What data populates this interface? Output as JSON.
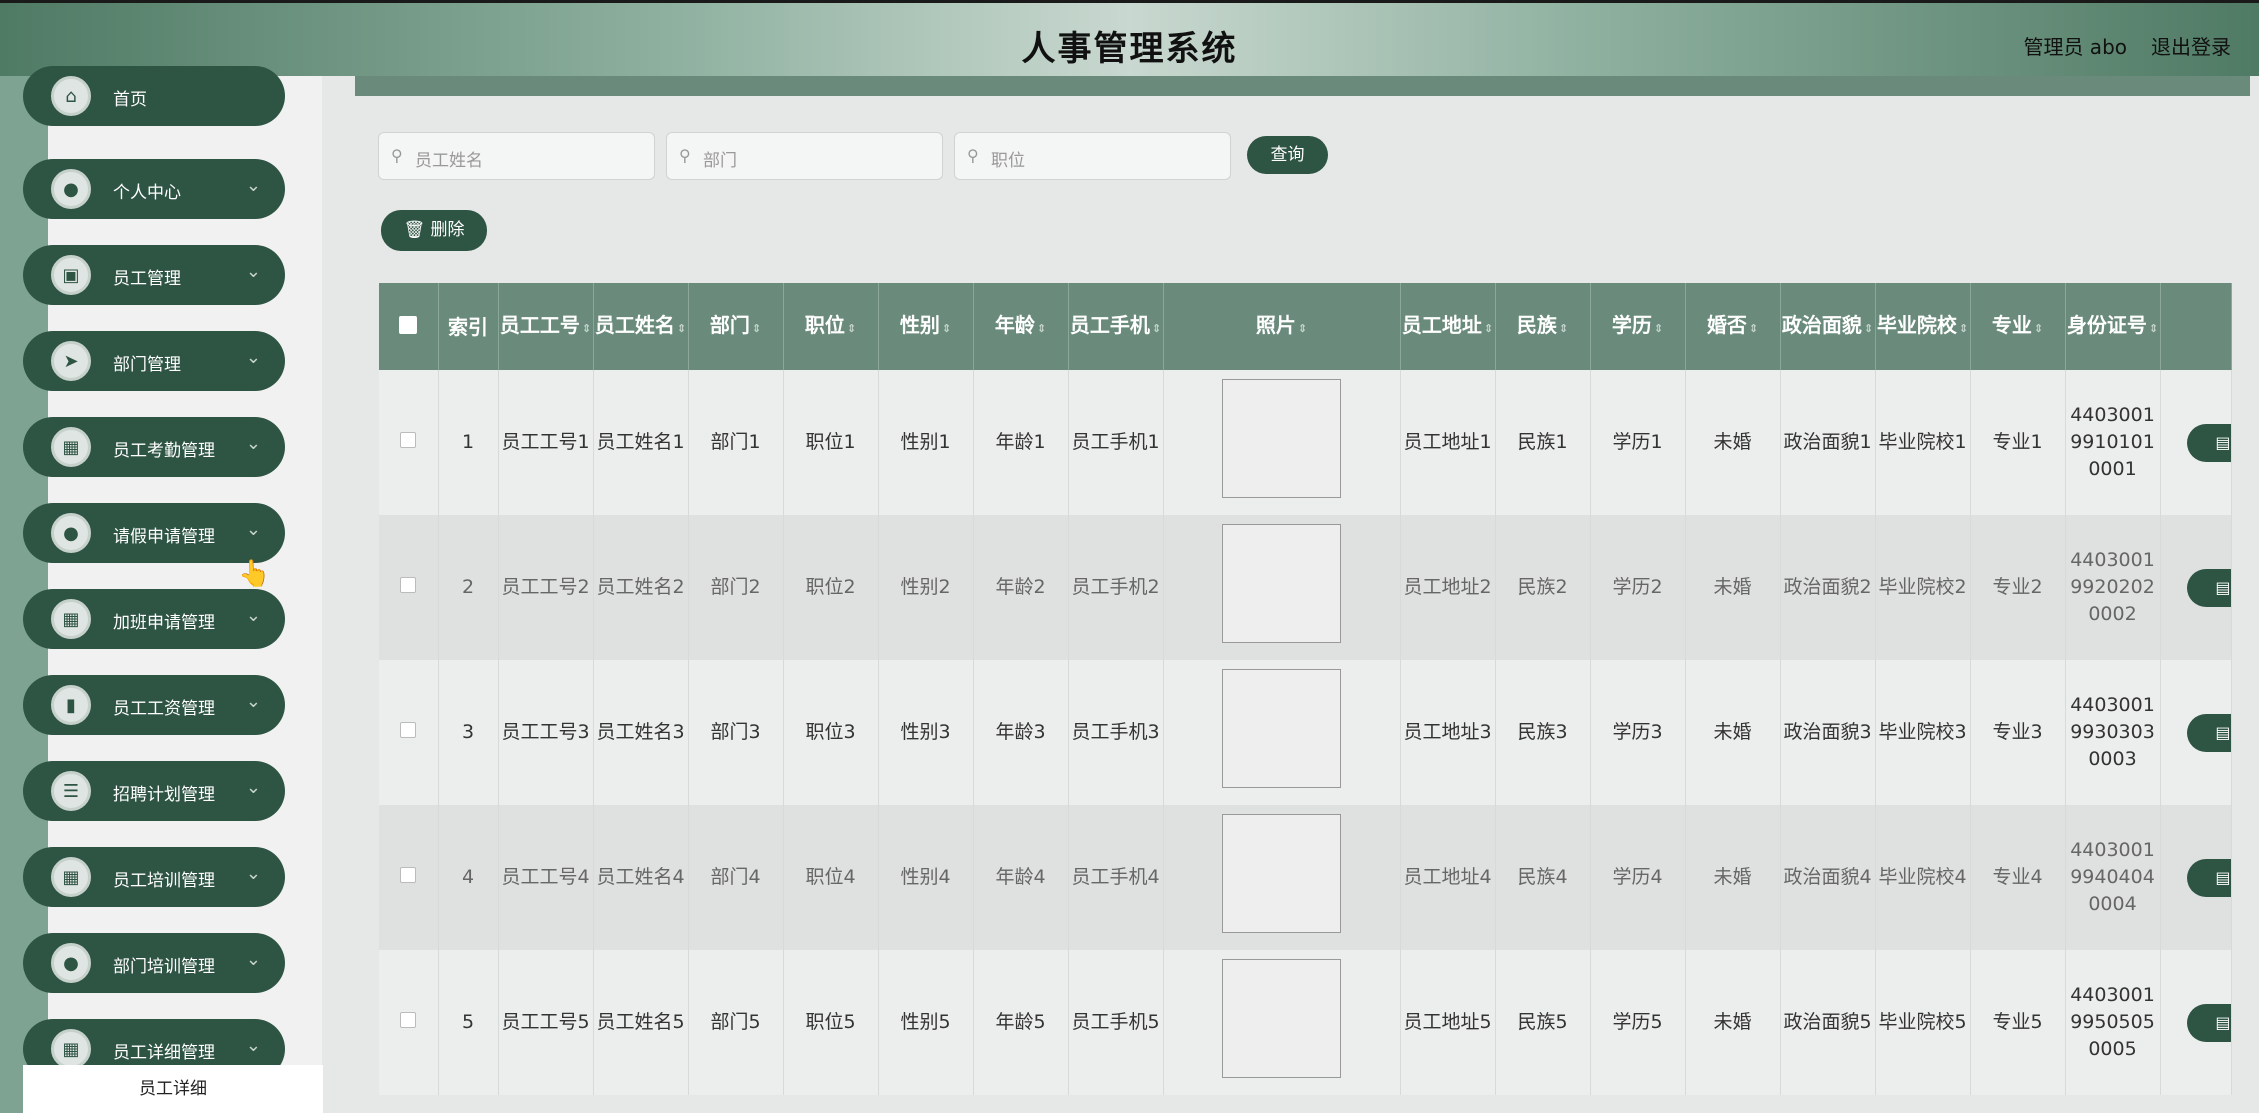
{
  "header": {
    "title": "人事管理系统",
    "user": "管理员 abo",
    "logout": "退出登录"
  },
  "sidebar": {
    "items": [
      {
        "label": "首页",
        "icon": "home-icon",
        "glyph": "⌂",
        "chevron": false
      },
      {
        "label": "个人中心",
        "icon": "user-icon",
        "glyph": "●",
        "chevron": true
      },
      {
        "label": "员工管理",
        "icon": "briefcase-icon",
        "glyph": "▣",
        "chevron": true
      },
      {
        "label": "部门管理",
        "icon": "send-icon",
        "glyph": "➤",
        "chevron": true
      },
      {
        "label": "员工考勤管理",
        "icon": "grid-icon",
        "glyph": "▦",
        "chevron": true
      },
      {
        "label": "请假申请管理",
        "icon": "user-icon",
        "glyph": "●",
        "chevron": true
      },
      {
        "label": "加班申请管理",
        "icon": "grid-icon",
        "glyph": "▦",
        "chevron": true
      },
      {
        "label": "员工工资管理",
        "icon": "bar-chart-icon",
        "glyph": "▮",
        "chevron": true
      },
      {
        "label": "招聘计划管理",
        "icon": "list-icon",
        "glyph": "☰",
        "chevron": true
      },
      {
        "label": "员工培训管理",
        "icon": "grid-icon",
        "glyph": "▦",
        "chevron": true
      },
      {
        "label": "部门培训管理",
        "icon": "user-icon",
        "glyph": "●",
        "chevron": true
      },
      {
        "label": "员工详细管理",
        "icon": "grid-icon",
        "glyph": "▦",
        "chevron": true
      }
    ],
    "submenu_label": "员工详细"
  },
  "search": {
    "name_placeholder": "员工姓名",
    "dept_placeholder": "部门",
    "position_placeholder": "职位",
    "query_label": "查询"
  },
  "actions": {
    "delete_label": "删除"
  },
  "table": {
    "headers": [
      "索引",
      "员工工号",
      "员工姓名",
      "部门",
      "职位",
      "性别",
      "年龄",
      "员工手机",
      "照片",
      "员工地址",
      "民族",
      "学历",
      "婚否",
      "政治面貌",
      "毕业院校",
      "专业",
      "身份证号"
    ],
    "rows": [
      {
        "index": "1",
        "emp_no": "员工工号1",
        "name": "员工姓名1",
        "dept": "部门1",
        "position": "职位1",
        "gender": "性别1",
        "age": "年龄1",
        "phone": "员工手机1",
        "address": "员工地址1",
        "ethnic": "民族1",
        "edu": "学历1",
        "married": "未婚",
        "political": "政治面貌1",
        "school": "毕业院校1",
        "major": "专业1",
        "id_no": "440300199101010001"
      },
      {
        "index": "2",
        "emp_no": "员工工号2",
        "name": "员工姓名2",
        "dept": "部门2",
        "position": "职位2",
        "gender": "性别2",
        "age": "年龄2",
        "phone": "员工手机2",
        "address": "员工地址2",
        "ethnic": "民族2",
        "edu": "学历2",
        "married": "未婚",
        "political": "政治面貌2",
        "school": "毕业院校2",
        "major": "专业2",
        "id_no": "440300199202020002"
      },
      {
        "index": "3",
        "emp_no": "员工工号3",
        "name": "员工姓名3",
        "dept": "部门3",
        "position": "职位3",
        "gender": "性别3",
        "age": "年龄3",
        "phone": "员工手机3",
        "address": "员工地址3",
        "ethnic": "民族3",
        "edu": "学历3",
        "married": "未婚",
        "political": "政治面貌3",
        "school": "毕业院校3",
        "major": "专业3",
        "id_no": "440300199303030003"
      },
      {
        "index": "4",
        "emp_no": "员工工号4",
        "name": "员工姓名4",
        "dept": "部门4",
        "position": "职位4",
        "gender": "性别4",
        "age": "年龄4",
        "phone": "员工手机4",
        "address": "员工地址4",
        "ethnic": "民族4",
        "edu": "学历4",
        "married": "未婚",
        "political": "政治面貌4",
        "school": "毕业院校4",
        "major": "专业4",
        "id_no": "440300199404040004"
      },
      {
        "index": "5",
        "emp_no": "员工工号5",
        "name": "员工姓名5",
        "dept": "部门5",
        "position": "职位5",
        "gender": "性别5",
        "age": "年龄5",
        "phone": "员工手机5",
        "address": "员工地址5",
        "ethnic": "民族5",
        "edu": "学历5",
        "married": "未婚",
        "political": "政治面貌5",
        "school": "毕业院校5",
        "major": "专业5",
        "id_no": "440300199505050005"
      }
    ]
  },
  "colors": {
    "primary": "#2e5444",
    "header_row": "#6a8b7c"
  }
}
